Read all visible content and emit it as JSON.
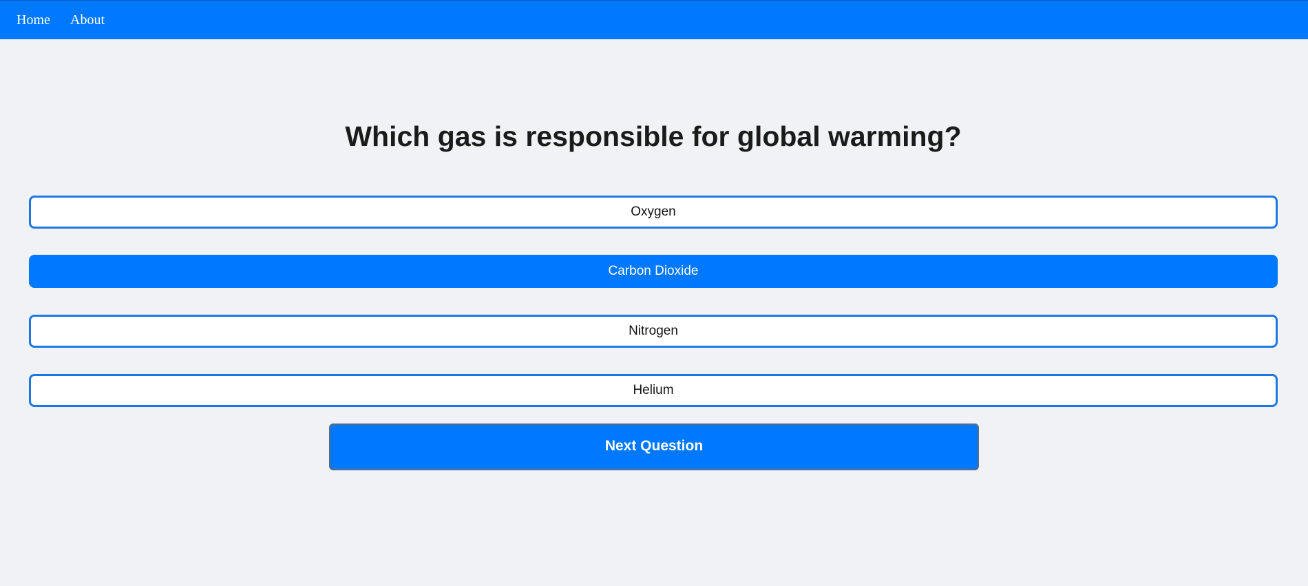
{
  "nav": {
    "home_label": "Home",
    "about_label": "About"
  },
  "quiz": {
    "question": "Which gas is responsible for global warming?",
    "options": [
      {
        "label": "Oxygen",
        "selected": false
      },
      {
        "label": "Carbon Dioxide",
        "selected": true
      },
      {
        "label": "Nitrogen",
        "selected": false
      },
      {
        "label": "Helium",
        "selected": false
      }
    ],
    "next_label": "Next Question"
  },
  "colors": {
    "accent": "#0078ff",
    "option_border": "#1b77e6",
    "background": "#f0f2f5",
    "question_text": "#1b1b1b"
  }
}
